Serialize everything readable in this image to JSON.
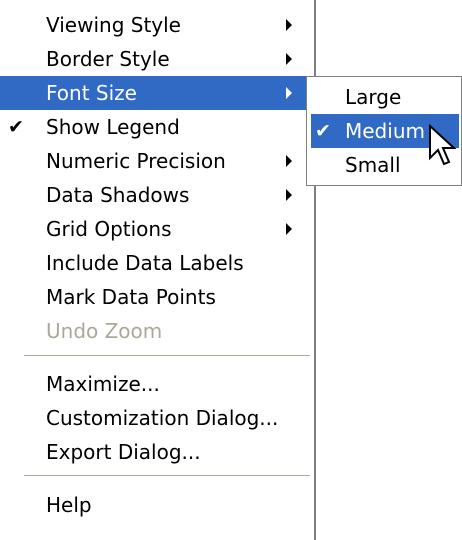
{
  "context_menu": {
    "items": [
      {
        "label": "Viewing Style"
      },
      {
        "label": "Border Style"
      },
      {
        "label": "Font Size"
      },
      {
        "label": "Show Legend",
        "check": "✔"
      },
      {
        "label": "Numeric Precision"
      },
      {
        "label": "Data Shadows"
      },
      {
        "label": "Grid Options"
      },
      {
        "label": "Include Data Labels"
      },
      {
        "label": "Mark Data Points"
      },
      {
        "label": "Undo Zoom"
      },
      {
        "label": "Maximize..."
      },
      {
        "label": "Customization Dialog..."
      },
      {
        "label": "Export Dialog..."
      },
      {
        "label": "Help"
      }
    ]
  },
  "font_size_submenu": {
    "items": [
      {
        "label": "Large"
      },
      {
        "label": "Medium",
        "check": "✔"
      },
      {
        "label": "Small"
      }
    ]
  },
  "colors": {
    "highlight": "#316ac5",
    "disabled_text": "#aca899"
  },
  "icons": {
    "submenu_arrow": "submenu-arrow-icon",
    "check": "checkmark-icon",
    "cursor": "mouse-pointer-icon"
  }
}
